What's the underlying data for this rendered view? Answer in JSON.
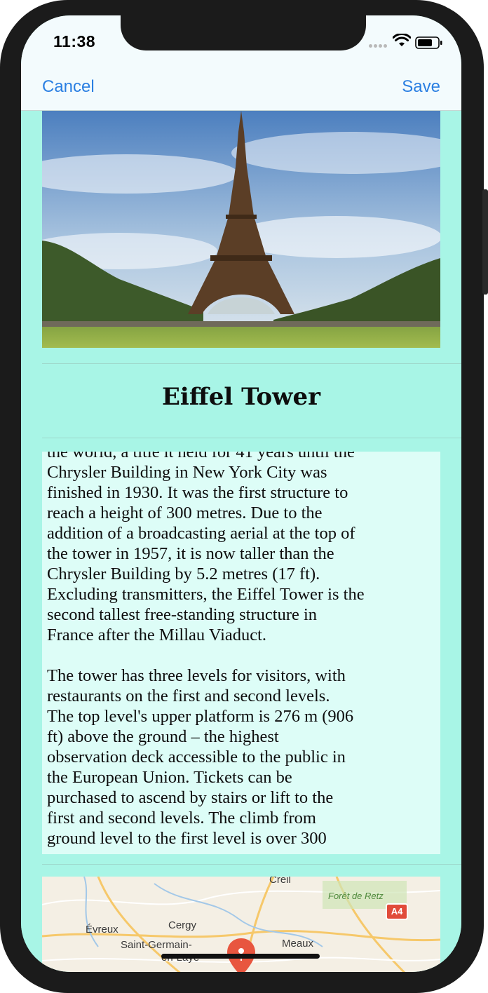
{
  "status_bar": {
    "time": "11:38"
  },
  "nav": {
    "cancel_label": "Cancel",
    "save_label": "Save"
  },
  "place": {
    "title": "Eiffel Tower",
    "description": "the world, a title it held for 41 years until the\nChrysler Building in New York City was\nfinished in 1930. It was the first structure to\nreach a height of 300 metres. Due to the\naddition of a broadcasting aerial at the top of\nthe tower in 1957, it is now taller than the\nChrysler Building by 5.2 metres (17 ft).\nExcluding transmitters, the Eiffel Tower is the\nsecond tallest free-standing structure in\nFrance after the Millau Viaduct.\n\nThe tower has three levels for visitors, with\nrestaurants on the first and second levels.\nThe top level's upper platform is 276 m (906\nft) above the ground – the highest\nobservation deck accessible to the public in\nthe European Union. Tickets can be\npurchased to ascend by stairs or lift to the\nfirst and second levels. The climb from\nground level to the first level is over 300"
  },
  "map": {
    "labels": {
      "creil": "Creil",
      "foret": "Forêt de Retz",
      "evreux": "Évreux",
      "cergy": "Cergy",
      "saint_germain_1": "Saint-Germain-",
      "saint_germain_2": "en-Laye",
      "meaux": "Meaux",
      "road": "A4"
    }
  },
  "colors": {
    "background": "#a8f5e6",
    "text_area": "#ddfdf7",
    "accent": "#2a7fe2",
    "pin": "#e8563f"
  }
}
